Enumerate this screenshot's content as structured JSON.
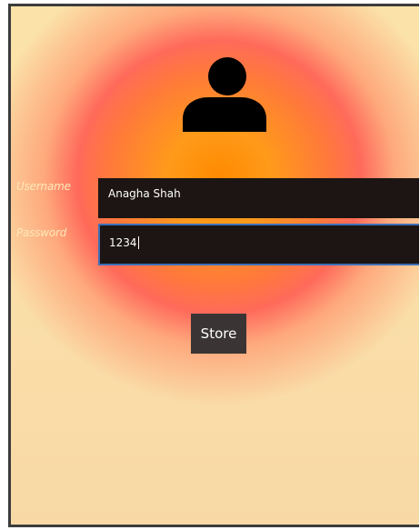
{
  "form": {
    "username_label": "Username",
    "username_value": "Anagha Shah",
    "password_label": "Password",
    "password_value": "1234",
    "store_label": "Store"
  },
  "icons": {
    "avatar": "user-silhouette-icon"
  },
  "colors": {
    "field_background": "#1c1513",
    "focus_border": "#3e6fb8",
    "button_background": "#3a3534",
    "label_text": "#ffe9b8"
  }
}
